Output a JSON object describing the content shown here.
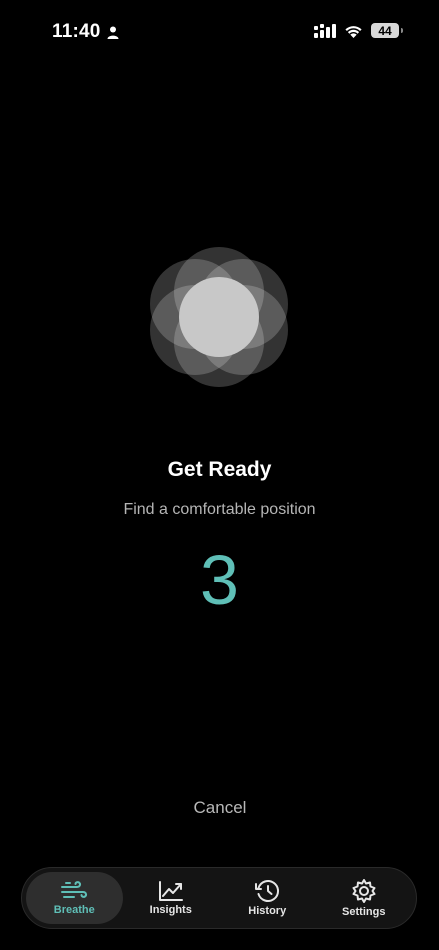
{
  "status_bar": {
    "time": "11:40",
    "battery": "44"
  },
  "session": {
    "title": "Get Ready",
    "subtitle": "Find a comfortable position",
    "countdown": "3",
    "cancel_label": "Cancel"
  },
  "tabs": [
    {
      "label": "Breathe",
      "icon": "wind-icon",
      "active": true
    },
    {
      "label": "Insights",
      "icon": "trend-chart-icon",
      "active": false
    },
    {
      "label": "History",
      "icon": "history-clock-icon",
      "active": false
    },
    {
      "label": "Settings",
      "icon": "gear-icon",
      "active": false
    }
  ],
  "colors": {
    "accent": "#5fbfb7",
    "background": "#000000",
    "tab_bar": "#141414",
    "tab_active": "#2e2e2e"
  }
}
